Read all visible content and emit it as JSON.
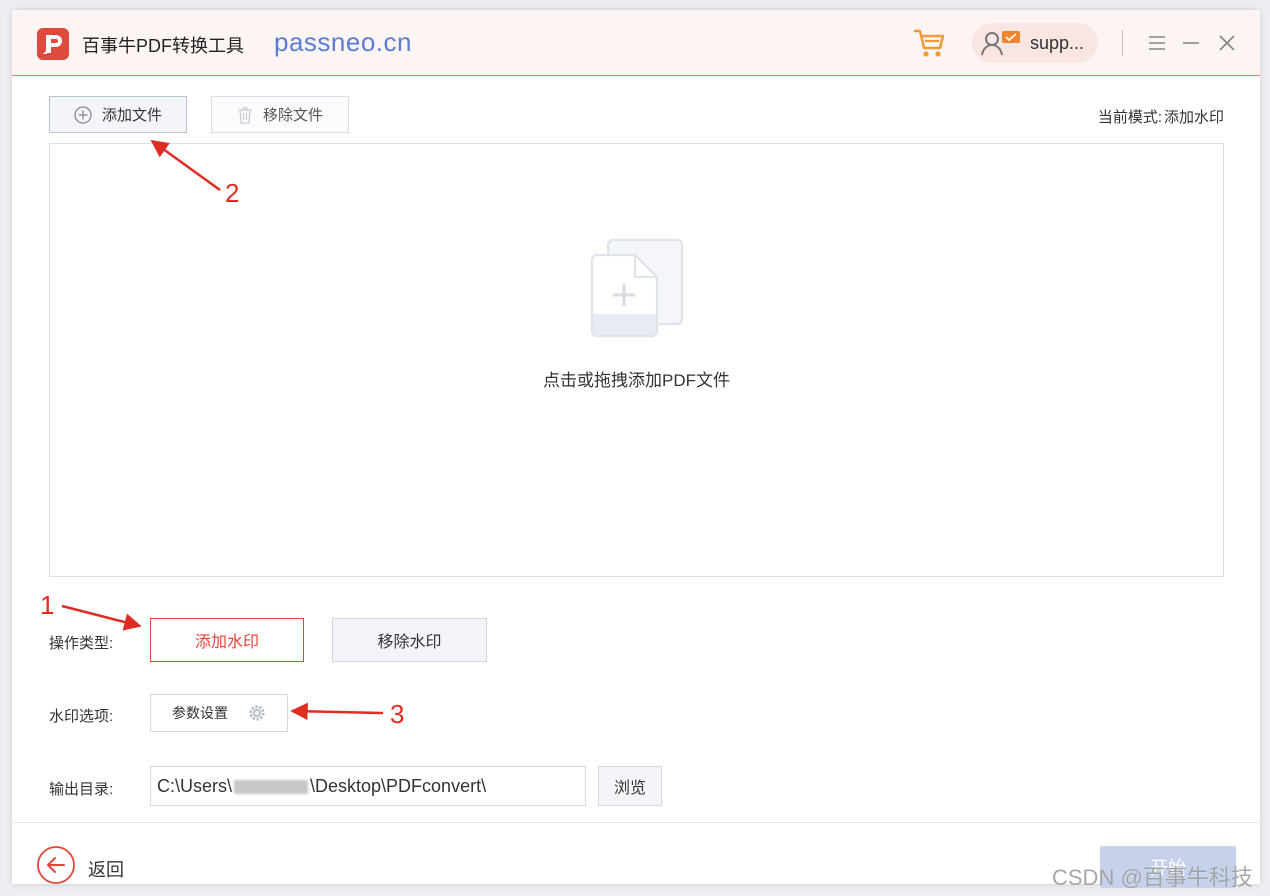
{
  "titlebar": {
    "app_title": "百事牛PDF转换工具",
    "site_label": "passneo.cn",
    "user_name": "supp..."
  },
  "toolbar": {
    "add_file_label": "添加文件",
    "remove_file_label": "移除文件",
    "mode_prefix": "当前模式:",
    "mode_value": "添加水印"
  },
  "dropzone": {
    "hint": "点击或拖拽添加PDF文件"
  },
  "operation": {
    "label": "操作类型:",
    "add_watermark": "添加水印",
    "remove_watermark": "移除水印"
  },
  "watermark_options": {
    "label": "水印选项:",
    "params_button": "参数设置"
  },
  "output": {
    "label": "输出目录:",
    "path_prefix": "C:\\Users\\",
    "path_suffix": "\\Desktop\\PDFconvert\\",
    "browse_label": "浏览"
  },
  "footer": {
    "back_label": "返回",
    "start_label": "开始"
  },
  "annotations": {
    "marker_1": "1",
    "marker_2": "2",
    "marker_3": "3"
  },
  "watermark_text": "CSDN @百事牛科技",
  "colors": {
    "accent_red": "#e0463a",
    "brand_blue": "#5b7dd8",
    "start_disabled": "#c6d1ec",
    "annotation_red": "#e02d22"
  }
}
